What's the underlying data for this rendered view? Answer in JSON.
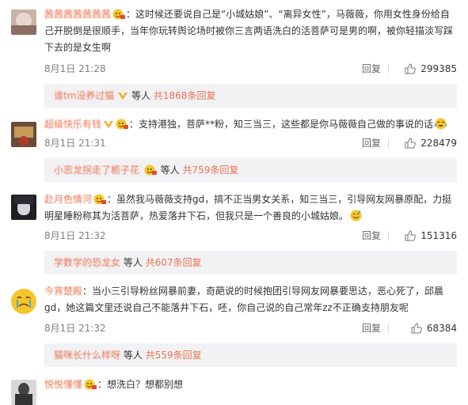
{
  "comments": [
    {
      "user": "茜茜茜茜茜茜茜",
      "text": "：这时候还要说自己是“小城姑娘”、“离异女性”，马薇薇，你用女性身份给自己开脱倒是很顺手，当年你玩转舆论场时被你三言两语洗白的活菩萨可是男的啊，被你轻描淡写踩下去的是女生啊",
      "time": "8月1日 21:28",
      "reply": "回复",
      "likes": "299385",
      "sub": {
        "who": "谁tm没养过猫",
        "mid": "等人",
        "more": "共1868条回复"
      }
    },
    {
      "user": "超级快乐有钱",
      "text": "：支持港独，菩萨**粉，知三当三，这些都是你马薇薇自己做的事说的话",
      "time": "8月1日 21:31",
      "reply": "回复",
      "likes": "228479",
      "sub": {
        "who": "小恶龙拐走了栀子花",
        "mid": "等人",
        "more": "共759条回复"
      }
    },
    {
      "user": "赴月色情河",
      "text": "：虽然我马薇薇支持gd，搞不正当男女关系，知三当三，引导网友网暴原配，力挺明星睡粉称其为活菩萨，热爱落井下石，但我只是一个善良的小城姑娘。",
      "time": "8月1日 21:32",
      "reply": "回复",
      "likes": "151316",
      "sub": {
        "who": "学数学的恐龙女",
        "mid": "等人",
        "more": "共607条回复"
      }
    },
    {
      "user": "今宵楚殿",
      "text": "：当小三引导粉丝网暴前妻，奇葩说的时候抱团引导网友网暴要思达，恶心死了，邱晨gd，她这篇文里还说自己不能落井下石，呸，你自己说的自己常年zz不正确支持朋友呢",
      "time": "8月1日 21:32",
      "reply": "回复",
      "likes": "68384",
      "sub": {
        "who": "猫咪长什么样呀",
        "mid": "等人",
        "more": "共559条回复"
      }
    },
    {
      "user": "悦悦懂懂",
      "text": "：想洗白？想都别想"
    }
  ],
  "colors": {
    "username": "#eb7350",
    "meta": "#808080",
    "subbar_bg": "#f2f2f5"
  },
  "icons": {
    "like": "thumbs-up-icon",
    "vip": "vip-crown-icon",
    "member": "member-badge-icon"
  }
}
